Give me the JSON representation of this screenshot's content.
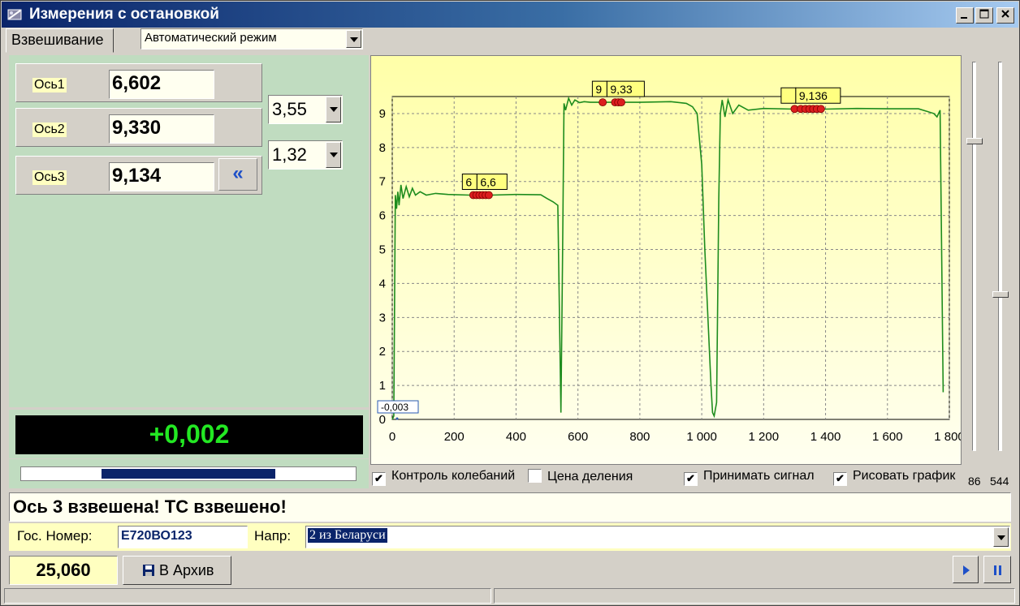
{
  "window": {
    "title": "Измерения с остановкой"
  },
  "tabs": {
    "active": "Взвешивание"
  },
  "mode": {
    "selected": "Автоматический режим"
  },
  "axes": [
    {
      "label": "Ось1",
      "value": "6,602"
    },
    {
      "label": "Ось2",
      "value": "9,330"
    },
    {
      "label": "Ось3",
      "value": "9,134"
    }
  ],
  "params": {
    "top": "3,55",
    "bottom": "1,32"
  },
  "back_button": "«",
  "display": {
    "current": "+0,002"
  },
  "progress": {
    "fill_start": 0.24,
    "fill_end": 0.76
  },
  "checkboxes": [
    {
      "label": "Контроль колебаний",
      "checked": true
    },
    {
      "label": "Цена деления",
      "checked": false
    },
    {
      "label": "Принимать сигнал",
      "checked": true
    },
    {
      "label": "Рисовать график",
      "checked": true
    }
  ],
  "sliders": [
    {
      "value": "86",
      "level": 0.8
    },
    {
      "value": "544",
      "level": 0.4
    }
  ],
  "status_message": "Ось 3 взвешена! ТС взвешено!",
  "plate": {
    "label": "Гос. Номер:",
    "value": "Е720ВО123"
  },
  "direction": {
    "label": "Напр:",
    "value": "2 из Беларуси"
  },
  "total": "25,060",
  "archive_button": "В Архив",
  "colors": {
    "chart_bg": "#ffffd8",
    "line": "#1e8c1e",
    "marker": "#dc1e1e",
    "display_text": "#23e823"
  },
  "chart_data": {
    "type": "line",
    "xlim": [
      0,
      1800
    ],
    "ylim": [
      0,
      9.5
    ],
    "x_ticks": [
      "0",
      "200",
      "400",
      "600",
      "800",
      "1 000",
      "1 200",
      "1 400",
      "1 600",
      "1 800"
    ],
    "y_ticks": [
      "0",
      "1",
      "2",
      "3",
      "4",
      "5",
      "6",
      "7",
      "8",
      "9"
    ],
    "grid": true,
    "baseline_label": "-0,003",
    "series": [
      {
        "x": [
          0,
          5,
          10,
          14,
          18,
          22,
          28,
          35,
          45,
          55,
          65,
          75,
          90,
          110,
          140,
          180,
          250,
          320,
          400,
          480,
          500,
          520,
          535,
          545,
          550,
          555,
          560,
          570,
          580,
          590,
          605,
          620,
          640,
          700,
          800,
          900,
          950,
          970,
          985,
          1000,
          1010,
          1020,
          1030,
          1035,
          1040,
          1048,
          1055,
          1060,
          1066,
          1075,
          1085,
          1100,
          1120,
          1150,
          1200,
          1300,
          1400,
          1500,
          1600,
          1700,
          1750,
          1760,
          1770,
          1780
        ],
        "y": [
          0.0,
          0.1,
          6.6,
          6.2,
          6.7,
          6.3,
          6.9,
          6.5,
          6.85,
          6.55,
          6.8,
          6.6,
          6.7,
          6.6,
          6.65,
          6.62,
          6.6,
          6.6,
          6.62,
          6.61,
          6.5,
          6.4,
          6.3,
          0.2,
          4.5,
          9.3,
          9.1,
          9.45,
          9.25,
          9.4,
          9.32,
          9.35,
          9.33,
          9.33,
          9.33,
          9.35,
          9.3,
          9.2,
          9.0,
          7.5,
          5.0,
          3.0,
          1.0,
          0.2,
          0.1,
          0.5,
          6.5,
          9.0,
          9.4,
          8.9,
          9.4,
          9.0,
          9.25,
          9.1,
          9.15,
          9.13,
          9.13,
          9.15,
          9.14,
          9.14,
          9.0,
          8.9,
          9.1,
          0.8
        ]
      }
    ],
    "annotations": [
      {
        "x": 300,
        "y": 6.6,
        "label": "6,6",
        "extra": "6",
        "points": [
          262,
          272,
          282,
          292,
          302,
          312
        ]
      },
      {
        "x": 720,
        "y": 9.33,
        "label": "9,33",
        "extra": "9",
        "points": [
          680,
          720,
          730,
          740
        ]
      },
      {
        "x": 1330,
        "y": 9.136,
        "label": "9,136",
        "extra": "",
        "points": [
          1300,
          1320,
          1335,
          1348,
          1360,
          1372,
          1385
        ]
      }
    ]
  }
}
